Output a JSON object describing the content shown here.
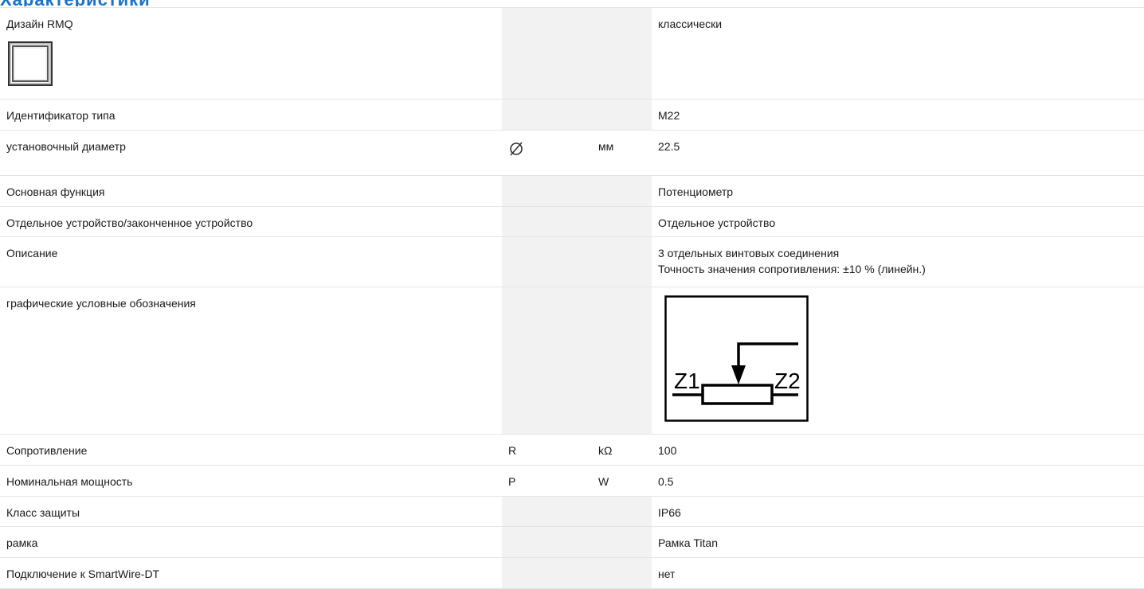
{
  "header": {
    "title": "Характеристики"
  },
  "rows": [
    {
      "name": "Дизайн RMQ",
      "symbol": "",
      "unit": "",
      "value": "классически",
      "icon": "rmq-design-square-icon"
    },
    {
      "name": "Идентификатор типа",
      "symbol": "",
      "unit": "",
      "value": "M22"
    },
    {
      "name": "установочный диаметр",
      "symbol": "",
      "unit": "мм",
      "value": "22.5",
      "symbol_icon": "diameter-icon"
    },
    {
      "name": "Основная функция",
      "symbol": "",
      "unit": "",
      "value": "Потенциометр"
    },
    {
      "name": "Отдельное устройство/законченное устройство",
      "symbol": "",
      "unit": "",
      "value": "Отдельное устройство"
    },
    {
      "name": "Описание",
      "symbol": "",
      "unit": "",
      "value": "3 отдельных винтовых соединения",
      "value2": "Точность значения сопротивления: ±10 % (линейн.)"
    },
    {
      "name": "графические условные обозначения",
      "symbol": "",
      "unit": "",
      "value": "",
      "value_image": "potentiometer-schematic",
      "schematic_labels": {
        "left": "Z1",
        "right": "Z2"
      }
    },
    {
      "name": "Сопротивление",
      "symbol": "R",
      "unit": "kΩ",
      "value": "100"
    },
    {
      "name": "Номинальная мощность",
      "symbol": "P",
      "unit": "W",
      "value": "0.5"
    },
    {
      "name": "Класс защиты",
      "symbol": "",
      "unit": "",
      "value": "IP66"
    },
    {
      "name": "рамка",
      "symbol": "",
      "unit": "",
      "value": "Рамка Titan"
    },
    {
      "name": "Подключение к SmartWire-DT",
      "symbol": "",
      "unit": "",
      "value": "нет"
    }
  ],
  "colors": {
    "title_blue": "#1a73c8",
    "grey_column": "#f2f2f2",
    "border": "#e4e4e4"
  }
}
